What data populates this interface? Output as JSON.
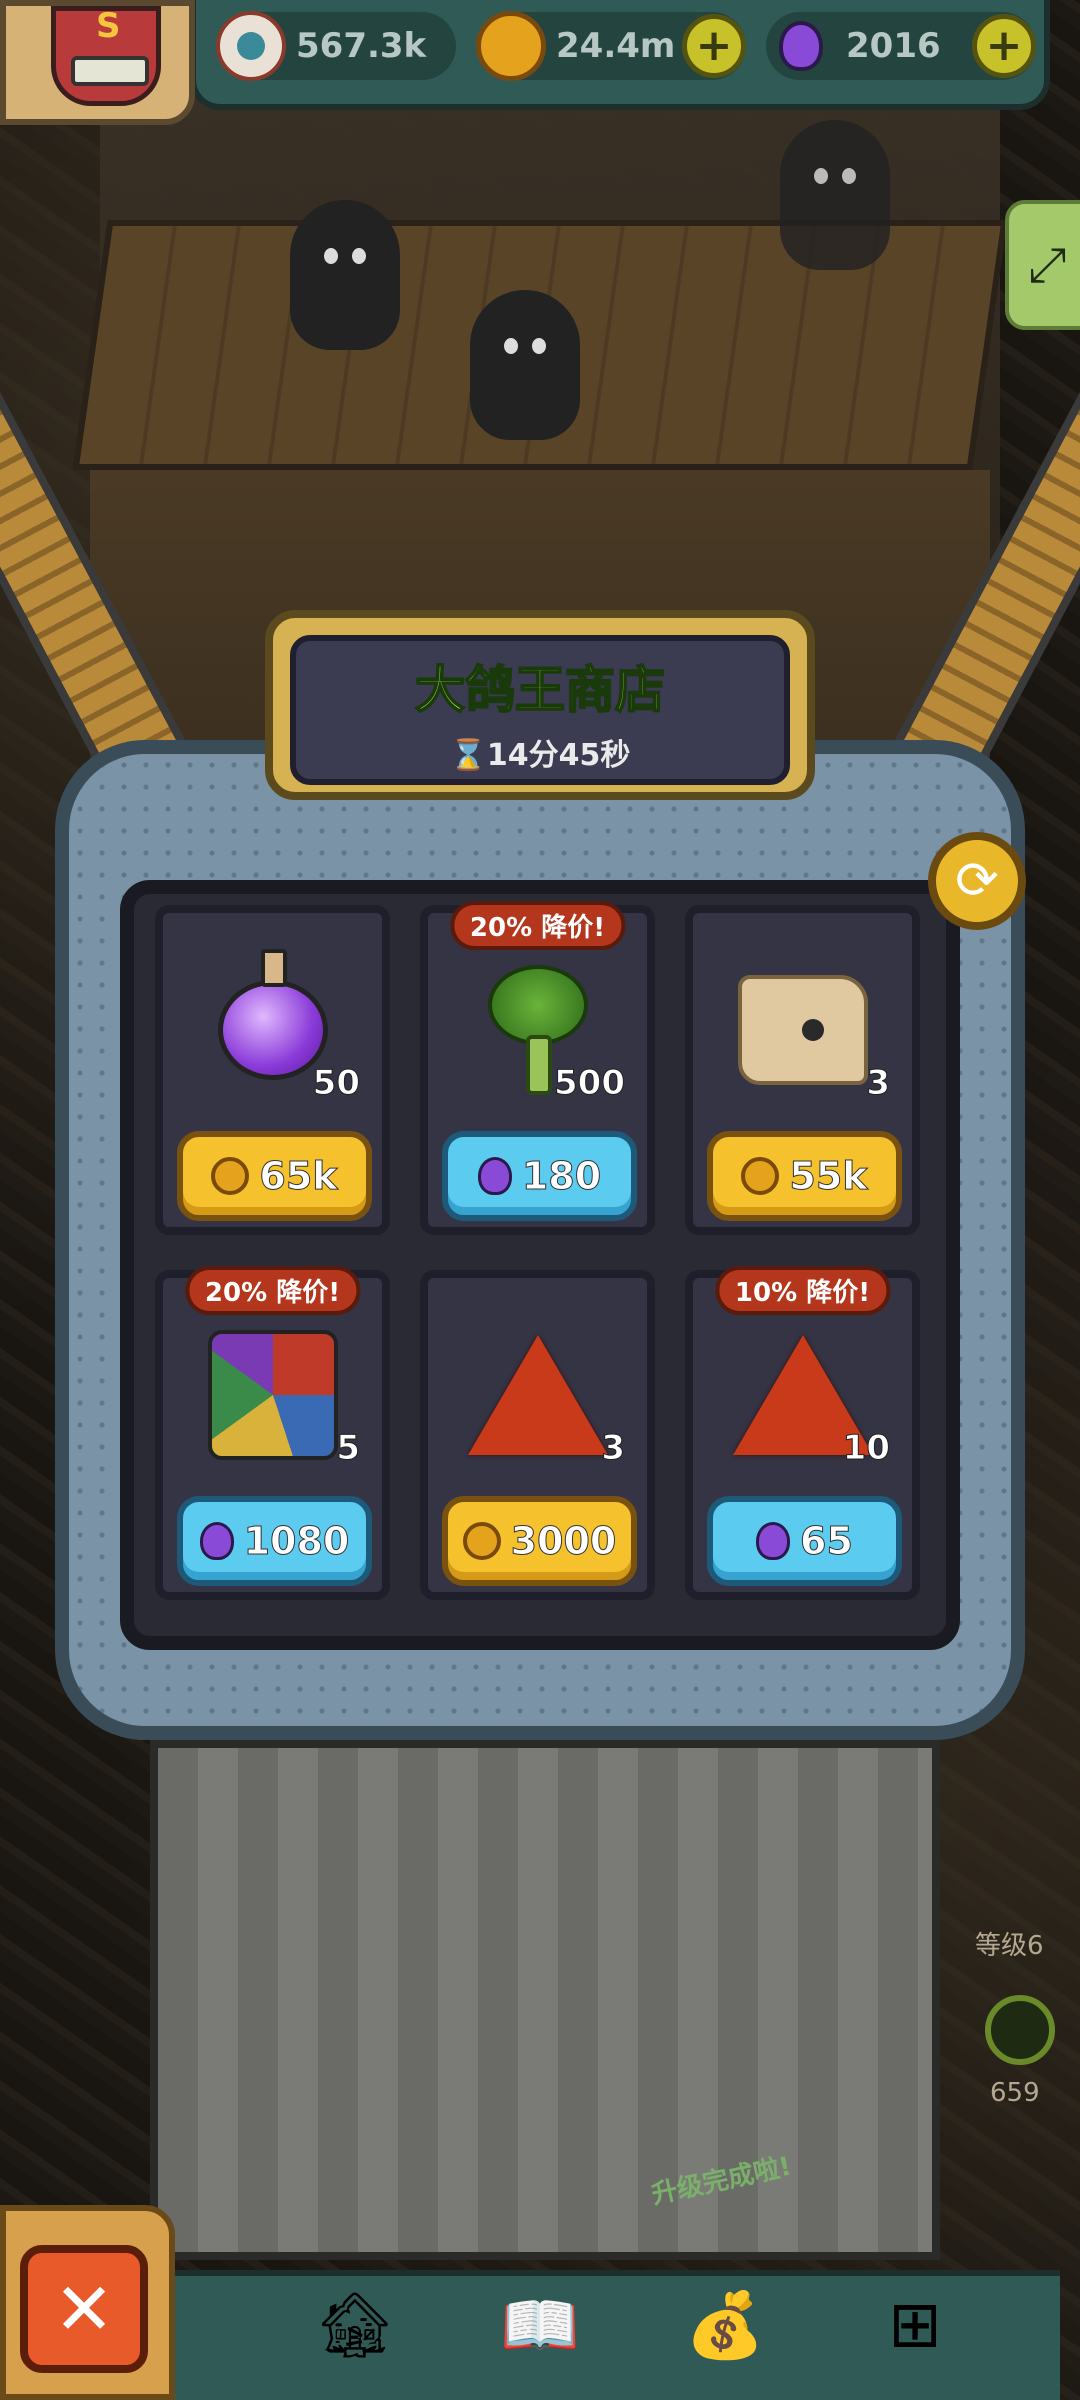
{
  "resources": {
    "eyes": "567.3k",
    "coins": "24.4m",
    "potions": "2016"
  },
  "shop": {
    "title": "大鸽王商店",
    "timer": "14分45秒",
    "items": [
      {
        "icon": "purple-potion-icon",
        "quantity": "50",
        "price": "65k",
        "currency": "coin",
        "badge": ""
      },
      {
        "icon": "broccoli-icon",
        "quantity": "500",
        "price": "180",
        "currency": "potion",
        "badge": "20% 降价!"
      },
      {
        "icon": "old-map-icon",
        "quantity": "3",
        "price": "55k",
        "currency": "coin",
        "badge": ""
      },
      {
        "icon": "junk-pile-icon",
        "quantity": "5",
        "price": "1080",
        "currency": "potion",
        "badge": "20% 降价!"
      },
      {
        "icon": "red-crystal-icon",
        "quantity": "3",
        "price": "3000",
        "currency": "coin",
        "badge": ""
      },
      {
        "icon": "red-crystal-icon",
        "quantity": "10",
        "price": "65",
        "currency": "potion",
        "badge": "10% 降价!"
      }
    ]
  },
  "sidebar": {
    "level": "等级6",
    "count": "659"
  },
  "scene": {
    "banner": "升级完成啦!"
  },
  "colors": {
    "accent_green": "#a5e64e",
    "coin_button": "#f5c22e",
    "potion_button": "#5ccbf0",
    "badge_red": "#b4361c",
    "close_button": "#e95a2a"
  }
}
